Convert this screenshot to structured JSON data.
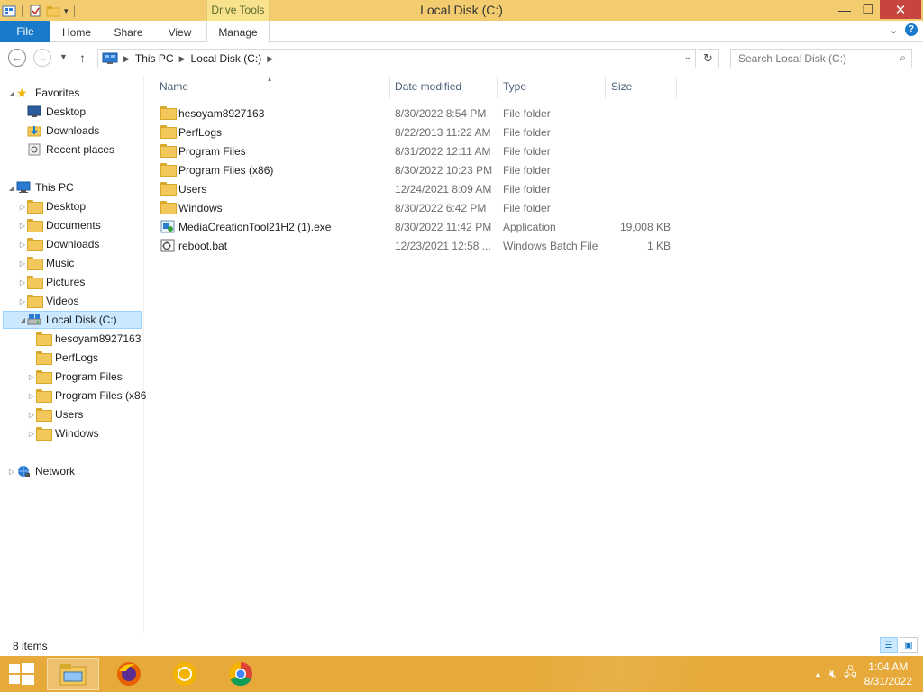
{
  "window": {
    "title": "Local Disk (C:)",
    "context_tab": "Drive Tools",
    "controls": {
      "minimize": "—",
      "maximize": "❐",
      "close": "✕"
    }
  },
  "ribbon": {
    "tabs": [
      "File",
      "Home",
      "Share",
      "View",
      "Manage"
    ],
    "expand_icon": "chevron-down-icon",
    "help_icon": "help-icon"
  },
  "address": {
    "crumbs": [
      "This PC",
      "Local Disk (C:)"
    ],
    "search_placeholder": "Search Local Disk (C:)"
  },
  "nav": {
    "favorites": {
      "label": "Favorites",
      "items": [
        "Desktop",
        "Downloads",
        "Recent places"
      ]
    },
    "this_pc": {
      "label": "This PC",
      "items": [
        "Desktop",
        "Documents",
        "Downloads",
        "Music",
        "Pictures",
        "Videos"
      ]
    },
    "local_disk": {
      "label": "Local Disk (C:)",
      "children": [
        "hesoyam8927163",
        "PerfLogs",
        "Program Files",
        "Program Files (x86",
        "Users",
        "Windows"
      ]
    },
    "network": {
      "label": "Network"
    }
  },
  "columns": {
    "name": "Name",
    "date": "Date modified",
    "type": "Type",
    "size": "Size"
  },
  "files": [
    {
      "name": "hesoyam8927163",
      "date": "8/30/2022 8:54 PM",
      "type": "File folder",
      "size": "",
      "icon": "folder-icon"
    },
    {
      "name": "PerfLogs",
      "date": "8/22/2013 11:22 AM",
      "type": "File folder",
      "size": "",
      "icon": "folder-icon"
    },
    {
      "name": "Program Files",
      "date": "8/31/2022 12:11 AM",
      "type": "File folder",
      "size": "",
      "icon": "folder-icon"
    },
    {
      "name": "Program Files (x86)",
      "date": "8/30/2022 10:23 PM",
      "type": "File folder",
      "size": "",
      "icon": "folder-icon"
    },
    {
      "name": "Users",
      "date": "12/24/2021 8:09 AM",
      "type": "File folder",
      "size": "",
      "icon": "folder-icon"
    },
    {
      "name": "Windows",
      "date": "8/30/2022 6:42 PM",
      "type": "File folder",
      "size": "",
      "icon": "folder-icon"
    },
    {
      "name": "MediaCreationTool21H2 (1).exe",
      "date": "8/30/2022 11:42 PM",
      "type": "Application",
      "size": "19,008 KB",
      "icon": "exe-icon"
    },
    {
      "name": "reboot.bat",
      "date": "12/23/2021 12:58 ...",
      "type": "Windows Batch File",
      "size": "1 KB",
      "icon": "batch-file-icon"
    }
  ],
  "status": {
    "item_count": "8 items"
  },
  "taskbar": {
    "apps": [
      "file-explorer",
      "firefox",
      "chrome-canary",
      "chrome"
    ],
    "time": "1:04 AM",
    "date": "8/31/2022"
  },
  "colors": {
    "titlebar": "#f2cc6e",
    "file_tab": "#1979ca",
    "taskbar": "#e7a93a",
    "selection": "#cce8ff"
  }
}
